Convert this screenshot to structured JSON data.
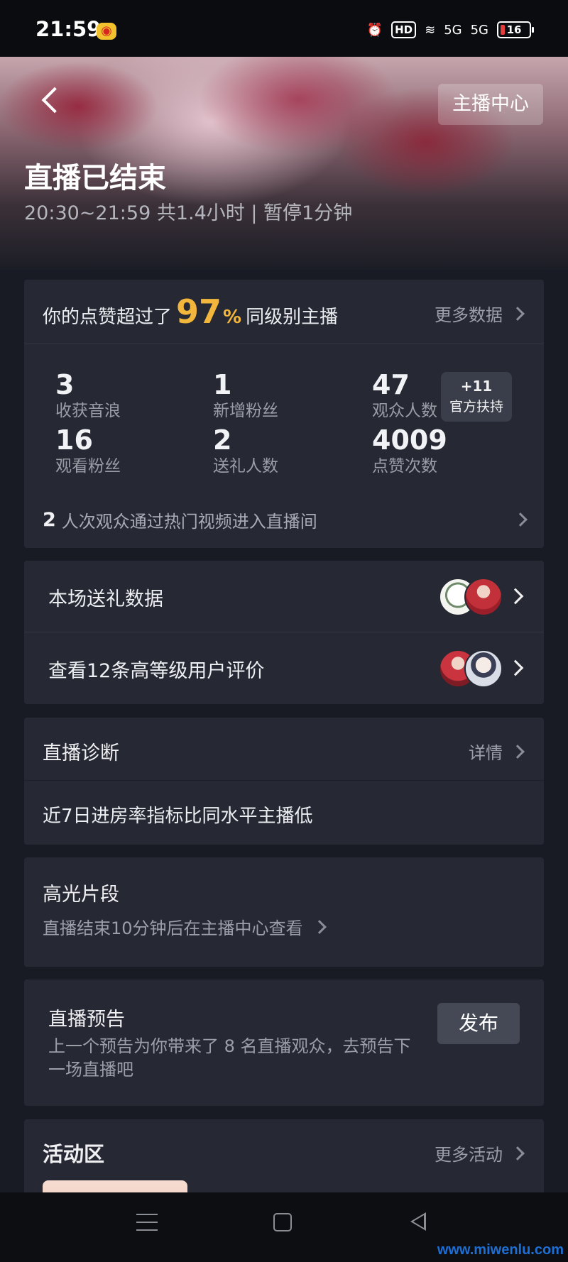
{
  "status_bar": {
    "time": "21:59",
    "hd": "HD",
    "net1": "5G",
    "net2": "5G",
    "battery": "16"
  },
  "header": {
    "anchor_center": "主播中心",
    "title": "直播已结束",
    "subtitle": "20:30~21:59 共1.4小时 | 暂停1分钟"
  },
  "stats": {
    "likes_prefix": "你的点赞超过了",
    "likes_pct": "97",
    "likes_pct_sign": "%",
    "likes_suffix": "同级别主播",
    "more_data": "更多数据",
    "items": [
      {
        "value": "3",
        "label": "收获音浪"
      },
      {
        "value": "1",
        "label": "新增粉丝"
      },
      {
        "value": "47",
        "label": "观众人数"
      },
      {
        "value": "16",
        "label": "观看粉丝"
      },
      {
        "value": "2",
        "label": "送礼人数"
      },
      {
        "value": "4009",
        "label": "点赞次数"
      }
    ],
    "support_badge": {
      "count": "+11",
      "label": "官方扶持"
    },
    "hot_count": "2",
    "hot_text": "人次观众通过热门视频进入直播间"
  },
  "gifts": {
    "gift_data": "本场送礼数据",
    "reviews": "查看12条高等级用户评价"
  },
  "diagnosis": {
    "title": "直播诊断",
    "detail": "详情",
    "body": "近7日进房率指标比同水平主播低"
  },
  "highlight": {
    "title": "高光片段",
    "subtitle": "直播结束10分钟后在主播中心查看"
  },
  "preview": {
    "title": "直播预告",
    "subtitle": "上一个预告为你带来了 8 名直播观众，去预告下一场直播吧",
    "button": "发布"
  },
  "activity": {
    "title": "活动区",
    "more": "更多活动"
  },
  "watermark": "www.miwenlu.com"
}
